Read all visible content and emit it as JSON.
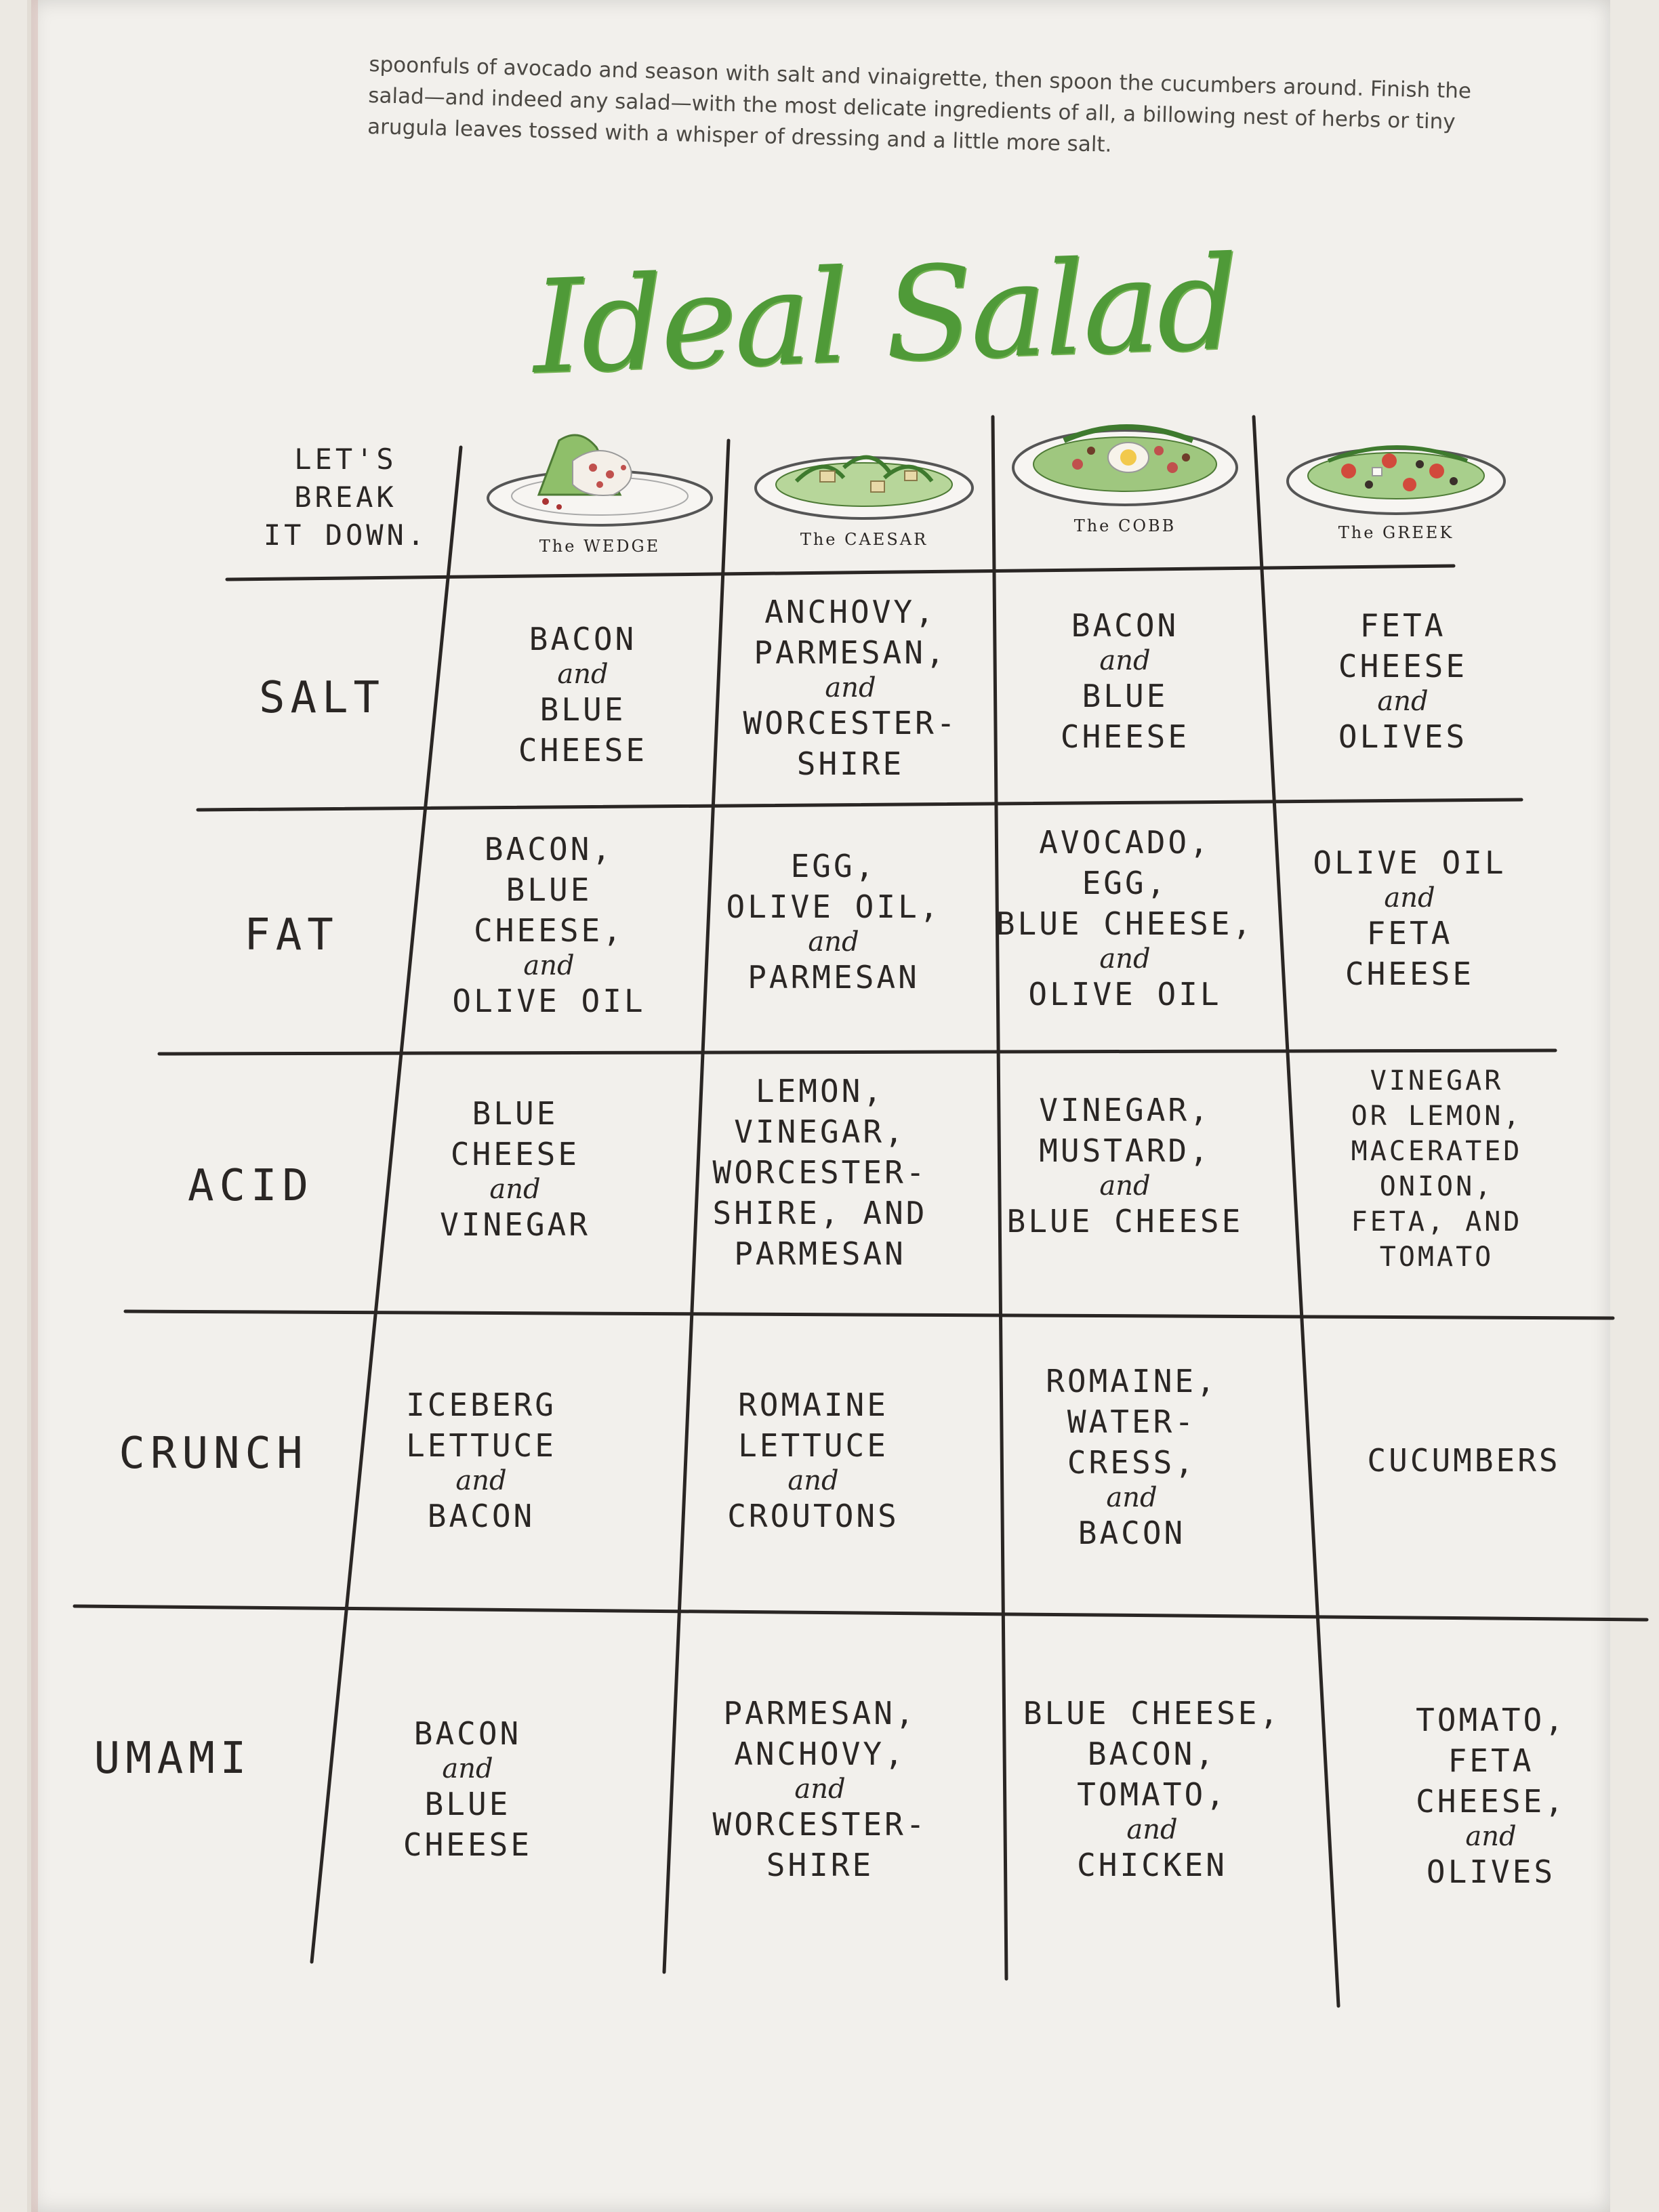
{
  "intro_text": "spoonfuls of avocado and season with salt and vinaigrette, then spoon the cucumbers around. Finish the salad—and indeed any salad—with the most delicate ingredients of all, a billowing nest of herbs or tiny arugula leaves tossed with a whisper of dressing and a little more salt.",
  "title": "Ideal Salad",
  "corner_label": [
    "LET'S",
    "BREAK",
    "IT DOWN."
  ],
  "columns": [
    {
      "name": "The WEDGE"
    },
    {
      "name": "The CAESAR"
    },
    {
      "name": "The COBB"
    },
    {
      "name": "The GREEK"
    }
  ],
  "rows": [
    {
      "label": "SALT",
      "cells": [
        [
          "BACON",
          "and",
          "BLUE",
          "CHEESE"
        ],
        [
          "ANCHOVY,",
          "PARMESAN,",
          "and",
          "WORCESTER-",
          "SHIRE"
        ],
        [
          "BACON",
          "and",
          "BLUE",
          "CHEESE"
        ],
        [
          "FETA",
          "CHEESE",
          "and",
          "OLIVES"
        ]
      ]
    },
    {
      "label": "FAT",
      "cells": [
        [
          "BACON,",
          "BLUE",
          "CHEESE,",
          "and",
          "OLIVE OIL"
        ],
        [
          "EGG,",
          "OLIVE OIL,",
          "and",
          "PARMESAN"
        ],
        [
          "AVOCADO,",
          "EGG,",
          "BLUE CHEESE,",
          "and",
          "OLIVE OIL"
        ],
        [
          "OLIVE OIL",
          "and",
          "FETA",
          "CHEESE"
        ]
      ]
    },
    {
      "label": "ACID",
      "cells": [
        [
          "BLUE",
          "CHEESE",
          "and",
          "VINEGAR"
        ],
        [
          "LEMON,",
          "VINEGAR,",
          "WORCESTER-",
          "SHIRE, and",
          "PARMESAN"
        ],
        [
          "VINEGAR,",
          "MUSTARD,",
          "and",
          "BLUE CHEESE"
        ],
        [
          "VINEGAR",
          "or LEMON,",
          "MACERATED",
          "ONION,",
          "FETA, and",
          "TOMATO"
        ]
      ]
    },
    {
      "label": "CRUNCH",
      "cells": [
        [
          "ICEBERG",
          "LETTUCE",
          "and",
          "BACON"
        ],
        [
          "ROMAINE",
          "LETTUCE",
          "and",
          "CROUTONS"
        ],
        [
          "ROMAINE,",
          "WATER-",
          "CRESS,",
          "and",
          "BACON"
        ],
        [
          "CUCUMBERS"
        ]
      ]
    },
    {
      "label": "UMAMI",
      "cells": [
        [
          "BACON",
          "and",
          "BLUE",
          "CHEESE"
        ],
        [
          "PARMESAN,",
          "ANCHOVY,",
          "and",
          "WORCESTER-",
          "SHIRE"
        ],
        [
          "BLUE CHEESE,",
          "BACON,",
          "TOMATO,",
          "and",
          "CHICKEN"
        ],
        [
          "TOMATO,",
          "FETA",
          "CHEESE,",
          "and",
          "OLIVES"
        ]
      ]
    }
  ],
  "colors": {
    "title_green": "#4f9a38",
    "ink": "#2a2624",
    "paper": "#f2f0ec"
  }
}
